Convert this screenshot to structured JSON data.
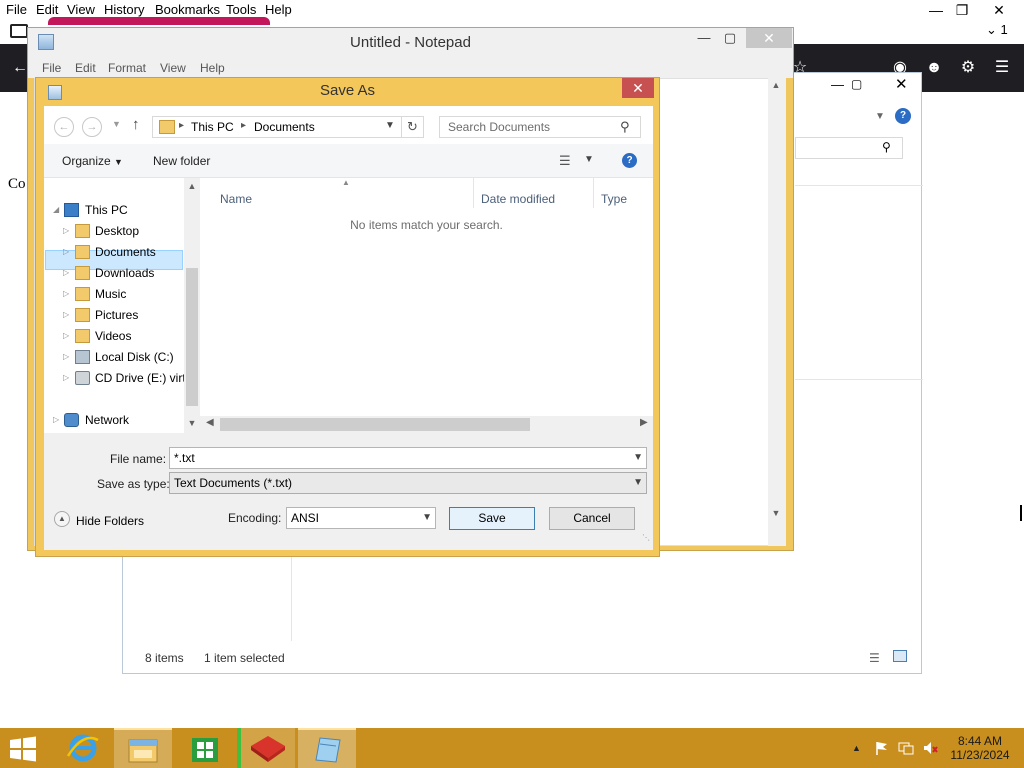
{
  "firefox": {
    "menu": [
      "File",
      "Edit",
      "View",
      "History",
      "Bookmarks",
      "Tools",
      "Help"
    ],
    "content_text": "Co",
    "tab_count_badge": "1"
  },
  "explorer": {
    "status_items": "8 items",
    "status_selected": "1 item selected"
  },
  "notepad": {
    "title": "Untitled - Notepad",
    "menu": [
      "File",
      "Edit",
      "Format",
      "View",
      "Help"
    ]
  },
  "saveas": {
    "title": "Save As",
    "breadcrumb": [
      "This PC",
      "Documents"
    ],
    "search_placeholder": "Search Documents",
    "organize_label": "Organize",
    "new_folder_label": "New folder",
    "tree": [
      {
        "label": "This PC",
        "icon": "pc-icon",
        "level": 0,
        "expanded": true
      },
      {
        "label": "Desktop",
        "icon": "folder-icon",
        "level": 1
      },
      {
        "label": "Documents",
        "icon": "folder-icon",
        "level": 1,
        "selected": true
      },
      {
        "label": "Downloads",
        "icon": "folder-icon",
        "level": 1
      },
      {
        "label": "Music",
        "icon": "folder-icon",
        "level": 1
      },
      {
        "label": "Pictures",
        "icon": "folder-icon",
        "level": 1
      },
      {
        "label": "Videos",
        "icon": "folder-icon",
        "level": 1
      },
      {
        "label": "Local Disk (C:)",
        "icon": "disk-icon",
        "level": 1
      },
      {
        "label": "CD Drive (E:) virti",
        "icon": "cd-icon",
        "level": 1
      },
      {
        "label": "Network",
        "icon": "network-icon",
        "level": 0
      }
    ],
    "columns": [
      "Name",
      "Date modified",
      "Type"
    ],
    "empty_message": "No items match your search.",
    "file_name_label": "File name:",
    "file_name_value": "*.txt",
    "save_type_label": "Save as type:",
    "save_type_value": "Text Documents (*.txt)",
    "hide_folders_label": "Hide Folders",
    "encoding_label": "Encoding:",
    "encoding_value": "ANSI",
    "save_label": "Save",
    "cancel_label": "Cancel"
  },
  "taskbar": {
    "time": "8:44 AM",
    "date": "11/23/2024"
  },
  "colors": {
    "window_frame": "#f4c75a",
    "taskbar": "#c88f1f",
    "close_button": "#c75050",
    "selection": "#cce8ff"
  }
}
